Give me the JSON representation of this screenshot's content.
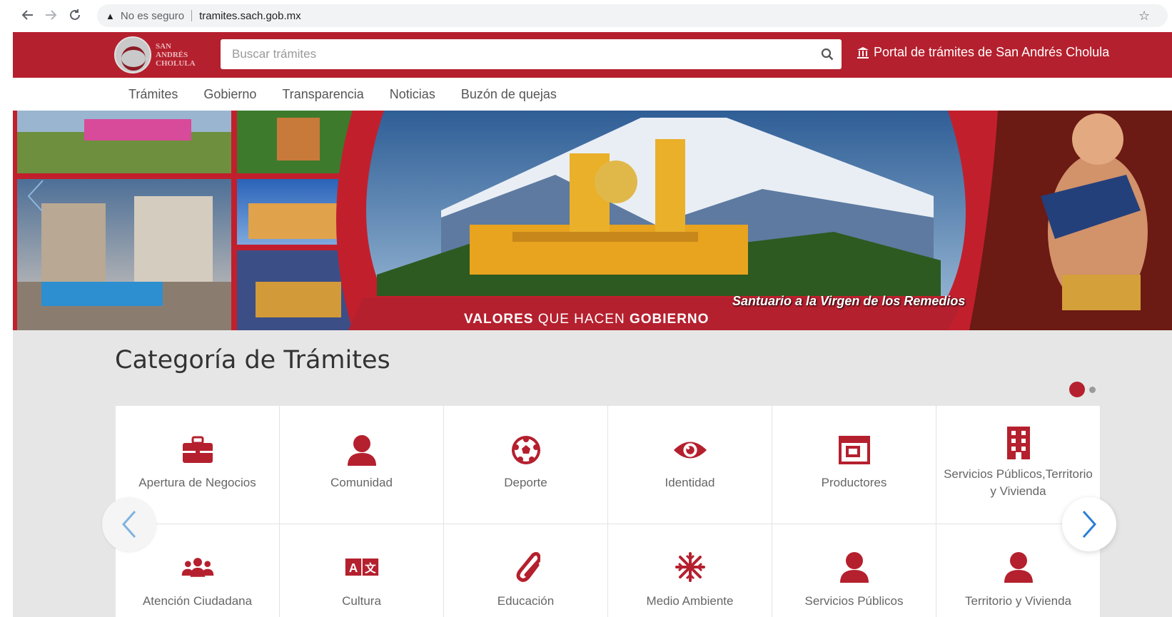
{
  "browser": {
    "security_label": "No es seguro",
    "url": "tramites.sach.gob.mx"
  },
  "header": {
    "logo_lines": [
      "San",
      "Andrés",
      "Cholula"
    ],
    "search_placeholder": "Buscar trámites",
    "portal_link": "Portal de trámites de San Andrés Cholula",
    "brand_color": "#b5202e"
  },
  "nav": {
    "items": [
      {
        "label": "Trámites"
      },
      {
        "label": "Gobierno"
      },
      {
        "label": "Transparencia"
      },
      {
        "label": "Noticias"
      },
      {
        "label": "Buzón de quejas"
      }
    ]
  },
  "banner": {
    "caption": "Santuario a la Virgen de los Remedios",
    "tagline_bold_1": "VALORES",
    "tagline_mid": " QUE HACEN ",
    "tagline_bold_2": "GOBIERNO"
  },
  "categories": {
    "title": "Categoría de Trámites",
    "items": [
      {
        "label": "Apertura de Negocios",
        "icon": "briefcase-icon"
      },
      {
        "label": "Comunidad",
        "icon": "user-icon"
      },
      {
        "label": "Deporte",
        "icon": "soccer-ball-icon"
      },
      {
        "label": "Identidad",
        "icon": "eye-icon"
      },
      {
        "label": "Productores",
        "icon": "window-icon"
      },
      {
        "label": "Servicios Públicos,Territorio y Vivienda",
        "icon": "building-icon"
      },
      {
        "label": "Atención Ciudadana",
        "icon": "users-icon"
      },
      {
        "label": "Cultura",
        "icon": "language-icon"
      },
      {
        "label": "Educación",
        "icon": "paperclip-icon"
      },
      {
        "label": "Medio Ambiente",
        "icon": "snowflake-icon"
      },
      {
        "label": "Servicios Públicos",
        "icon": "user-icon"
      },
      {
        "label": "Territorio y Vivienda",
        "icon": "user-icon"
      }
    ]
  }
}
